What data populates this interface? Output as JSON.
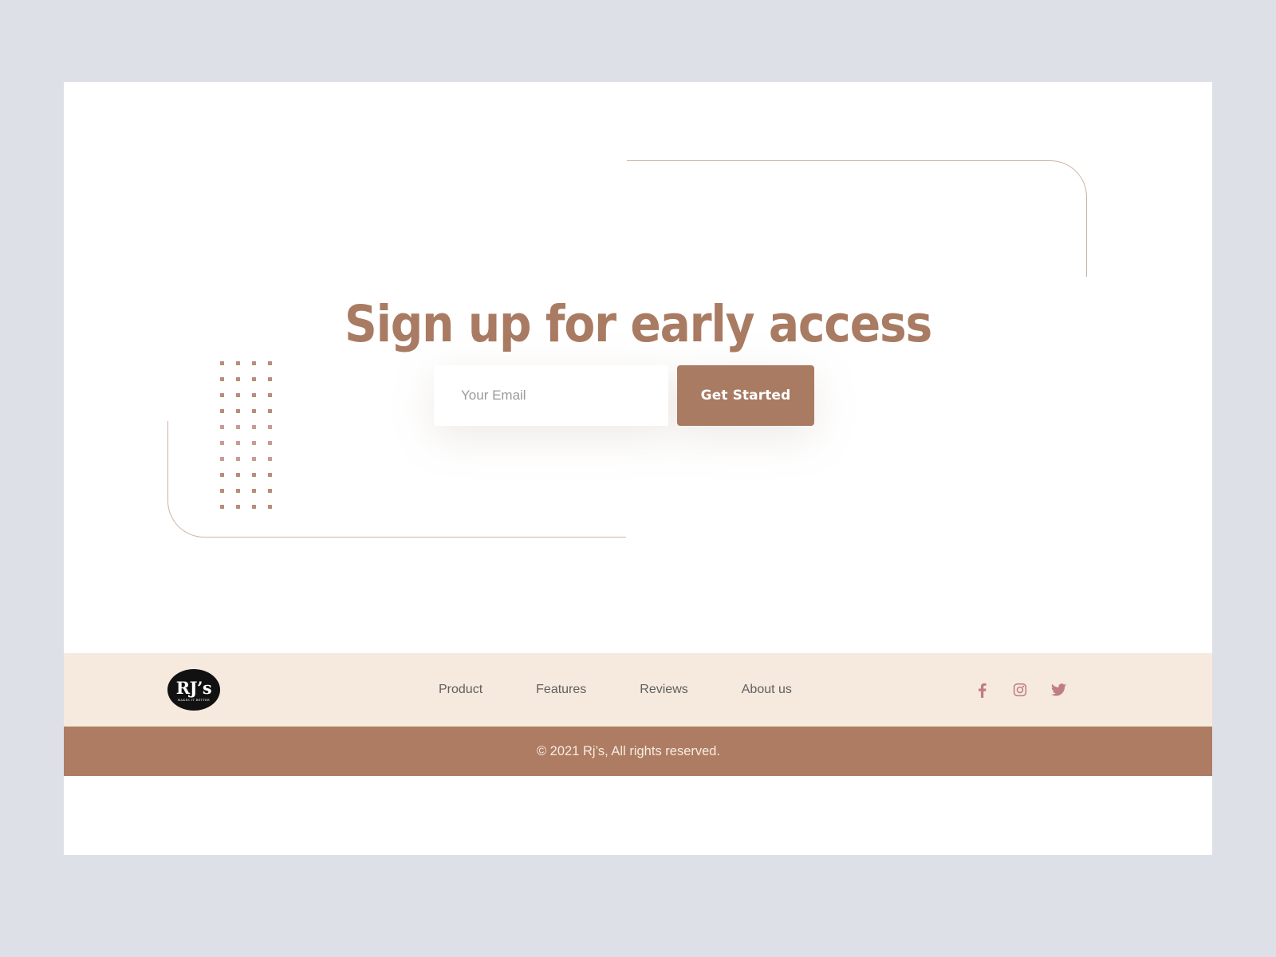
{
  "theme": {
    "page_background": "#dee0e8",
    "card_background": "#ffffff",
    "accent_brown": "#a97b63",
    "footer_cream": "#f6eade",
    "footer_bar_brown": "#ae7c62",
    "social_rose": "#c07d84",
    "deco_line": "#cdb4a6"
  },
  "hero": {
    "heading": "Sign up for early access"
  },
  "signup": {
    "email_placeholder": "Your Email",
    "email_value": "",
    "submit_label": "Get Started"
  },
  "decor": {
    "dot_grid": {
      "columns": 4,
      "rows": 10
    }
  },
  "footer": {
    "logo": {
      "mark": "RJ’s",
      "tagline": "MAKES IT BETTER"
    },
    "nav": [
      {
        "label": "Product"
      },
      {
        "label": "Features"
      },
      {
        "label": "Reviews"
      },
      {
        "label": "About us"
      }
    ],
    "social": [
      {
        "name": "facebook",
        "icon": "facebook-icon"
      },
      {
        "name": "instagram",
        "icon": "instagram-icon"
      },
      {
        "name": "twitter",
        "icon": "twitter-icon"
      }
    ],
    "copyright": "© 2021 Rj’s, All rights reserved."
  }
}
